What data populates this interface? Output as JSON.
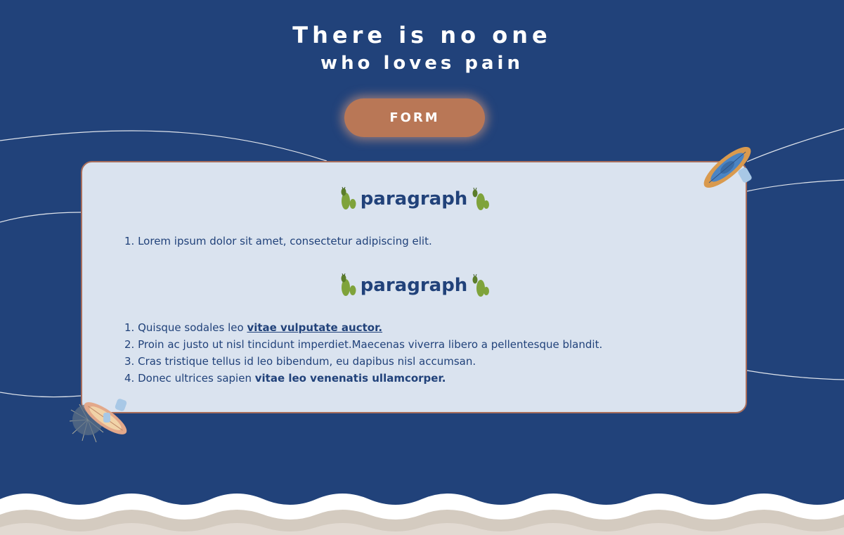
{
  "hero": {
    "line1": "There is no one",
    "line2": "who loves pain"
  },
  "form_button": {
    "label": "FORM"
  },
  "card": {
    "section1": {
      "heading": "paragraph",
      "items": [
        {
          "num": "1.",
          "text": "Lorem ipsum dolor sit amet, consectetur adipiscing elit."
        }
      ]
    },
    "section2": {
      "heading": "paragraph",
      "items": [
        {
          "num": "1.",
          "text": "Quisque sodales leo ",
          "link": "vitae vulputate auctor."
        },
        {
          "num": "2.",
          "text": "Proin ac justo ut nisl tincidunt imperdiet.Maecenas viverra libero a pellentesque blandit."
        },
        {
          "num": "3.",
          "text": "Cras tristique tellus id leo bibendum, eu dapibus nisl accumsan."
        },
        {
          "num": "4.",
          "text": "Donec ultrices sapien ",
          "bold": "vitae leo venenatis ullamcorper."
        }
      ]
    }
  },
  "icons": {
    "cactus": "cactus-icon",
    "boat_top": "kayak-icon",
    "boat_bottom": "rowboat-icon"
  },
  "colors": {
    "background": "#21427a",
    "button": "#b97756",
    "card": "#dae3ef",
    "card_border": "#a86e5c",
    "text": "#21427a"
  }
}
